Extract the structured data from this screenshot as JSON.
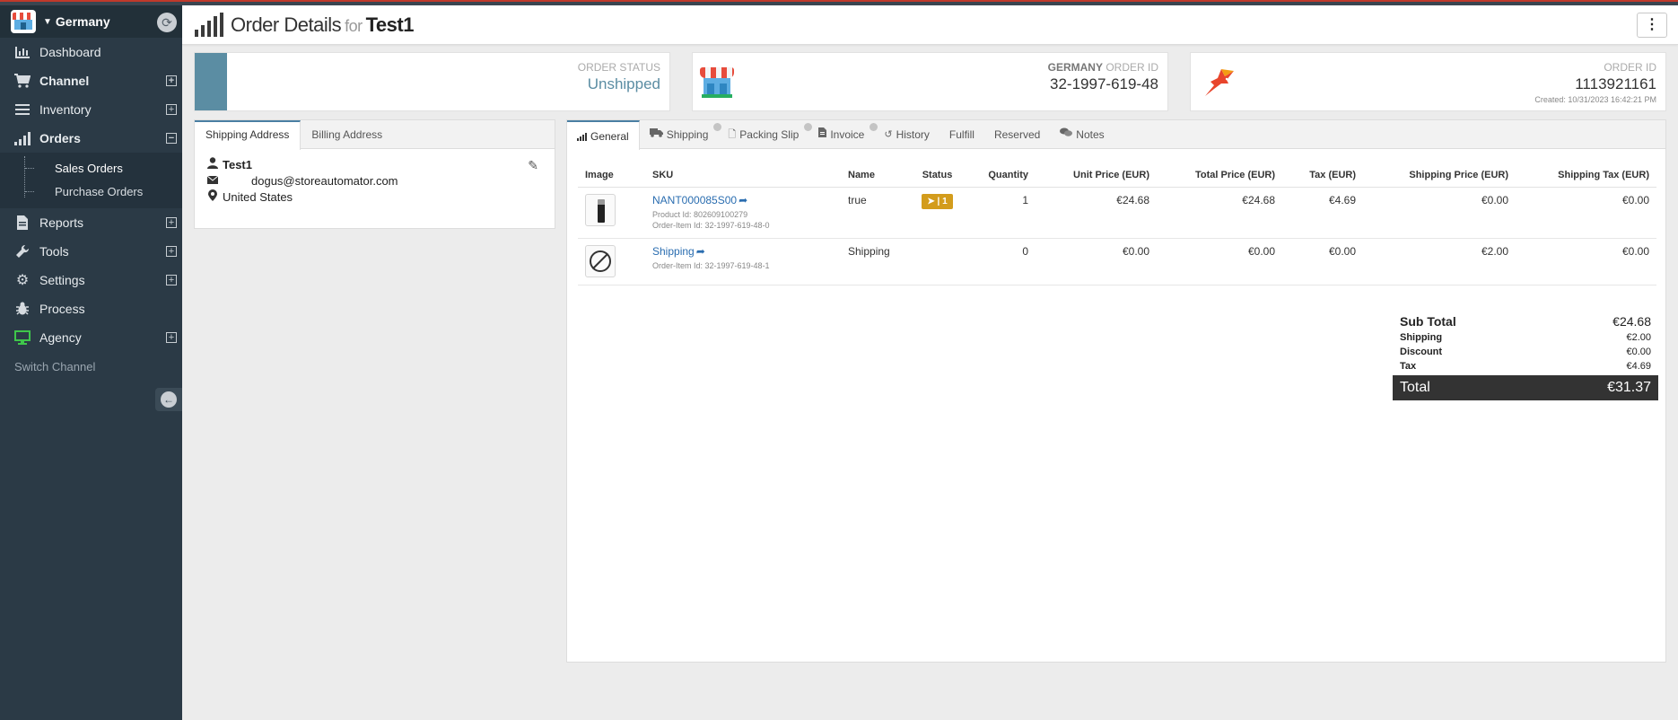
{
  "sidebar": {
    "channel": "Germany",
    "items": [
      {
        "label": "Dashboard"
      },
      {
        "label": "Channel"
      },
      {
        "label": "Inventory"
      },
      {
        "label": "Orders"
      },
      {
        "label": "Reports"
      },
      {
        "label": "Tools"
      },
      {
        "label": "Settings"
      },
      {
        "label": "Process"
      },
      {
        "label": "Agency"
      }
    ],
    "orders_sub": [
      {
        "label": "Sales Orders"
      },
      {
        "label": "Purchase Orders"
      }
    ],
    "switch_channel": "Switch Channel"
  },
  "header": {
    "title": "Order Details",
    "for": "for",
    "customer": "Test1"
  },
  "cards": {
    "status_label": "ORDER STATUS",
    "status_value": "Unshipped",
    "channel_label_bold": "GERMANY",
    "channel_label": "ORDER ID",
    "channel_order_id": "32-1997-619-48",
    "order_label": "ORDER ID",
    "order_id": "1113921161",
    "created": "Created: 10/31/2023 16:42:21 PM"
  },
  "address": {
    "tabs": [
      "Shipping Address",
      "Billing Address"
    ],
    "name": "Test1",
    "email": "dogus@storeautomator.com",
    "country": "United States"
  },
  "order_tabs": [
    "General",
    "Shipping",
    "Packing Slip",
    "Invoice",
    "History",
    "Fulfill",
    "Reserved",
    "Notes"
  ],
  "table": {
    "headers": [
      "Image",
      "SKU",
      "Name",
      "Status",
      "Quantity",
      "Unit Price (EUR)",
      "Total Price (EUR)",
      "Tax (EUR)",
      "Shipping Price (EUR)",
      "Shipping Tax (EUR)"
    ],
    "rows": [
      {
        "sku": "NANT000085S00",
        "product_id": "Product Id: 802609100279",
        "order_item_id": "Order-Item Id: 32-1997-619-48-0",
        "name": "true",
        "status": "1",
        "quantity": "1",
        "unit_price": "€24.68",
        "total_price": "€24.68",
        "tax": "€4.69",
        "shipping_price": "€0.00",
        "shipping_tax": "€0.00"
      },
      {
        "sku": "Shipping",
        "order_item_id": "Order-Item Id: 32-1997-619-48-1",
        "name": "Shipping",
        "quantity": "0",
        "unit_price": "€0.00",
        "total_price": "€0.00",
        "tax": "€0.00",
        "shipping_price": "€2.00",
        "shipping_tax": "€0.00"
      }
    ]
  },
  "totals": {
    "subtotal_label": "Sub Total",
    "subtotal": "€24.68",
    "shipping_label": "Shipping",
    "shipping": "€2.00",
    "discount_label": "Discount",
    "discount": "€0.00",
    "tax_label": "Tax",
    "tax": "€4.69",
    "total_label": "Total",
    "total": "€31.37"
  },
  "colors": {
    "sidebar": "#2b3a46",
    "accent": "#5b8da3",
    "link": "#2a6db0",
    "badge": "#d39c1c"
  }
}
